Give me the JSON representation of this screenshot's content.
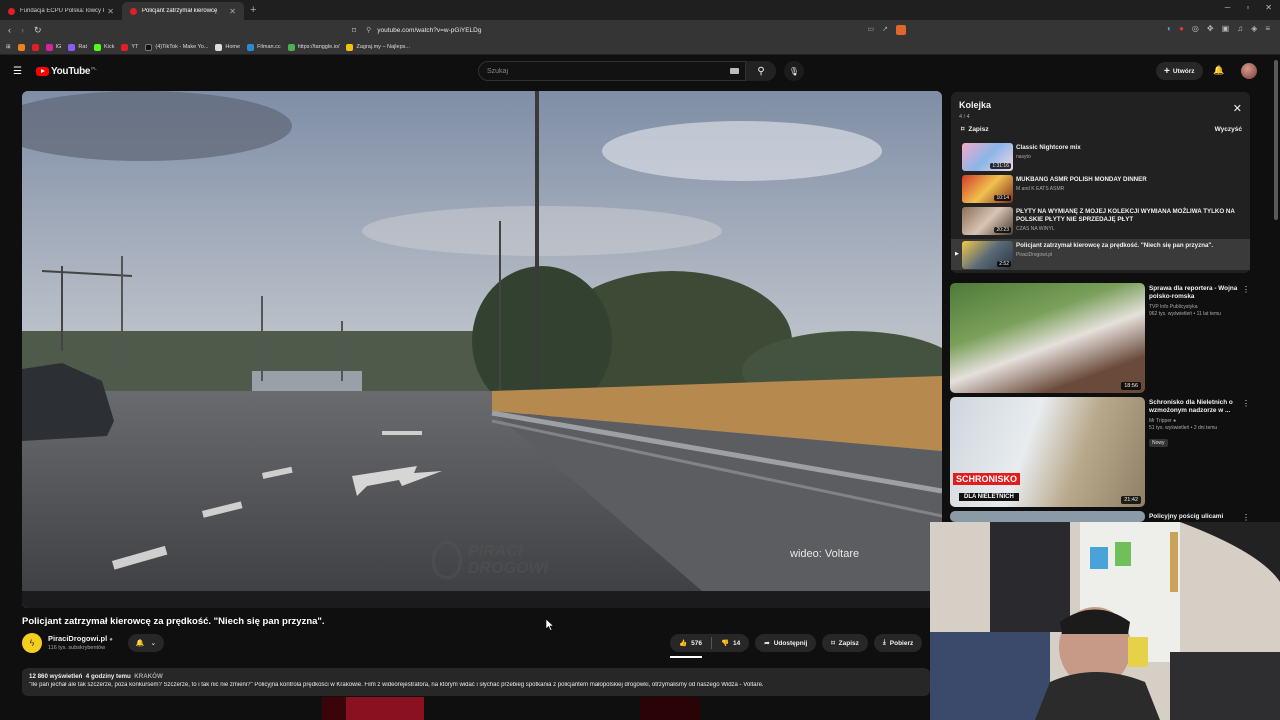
{
  "browser": {
    "tabs": [
      {
        "title": "Fundacja ECPU Polska: łowcy Pedofi",
        "active": false
      },
      {
        "title": "Policjant zatrzymał kierowcę",
        "active": true
      }
    ],
    "url": "youtube.com/watch?v=w-pGiYELDg",
    "bookmarks": [
      "IG",
      "Rat",
      "Kick",
      "YT",
      "(4)TikTok - Make Yo...",
      "Home",
      "Filman.cc",
      "https://tanggle.io/",
      "Zagraj.my – Najleps..."
    ]
  },
  "header": {
    "logo_text": "YouTube",
    "country": "PL",
    "search_placeholder": "Szukaj",
    "create_label": "Utwórz"
  },
  "player": {
    "watermark_line1": "PIRACI",
    "watermark_line2": "DROGOWI",
    "credit": "wideo: Voltare"
  },
  "video": {
    "title": "Policjant zatrzymał kierowcę za prędkość. \"Niech się pan przyzna\".",
    "channel": "PiraciDrogowi.pl",
    "subscribers": "116 tys. subskrybentów",
    "likes": "576",
    "dislikes": "14",
    "share_label": "Udostępnij",
    "save_label": "Zapisz",
    "download_label": "Pobierz",
    "views": "12 860 wyświetleń",
    "age": "4 godziny temu",
    "tag": "KRAKÓW",
    "description": "\"Ile pan jechał ale tak szczerze, poza konkursem? Szczerze, to i tak nic nie zmieni?\" Policyjna kontrola prędkości w Krakowie. Film z wideorejestratora, na którym widać i słychać przebieg spotkania z policjantem małopolskiej drogówki, otrzymaliśmy od naszego Widza - Voltare."
  },
  "queue": {
    "title": "Kolejka",
    "count": "4 / 4",
    "save_label": "Zapisz",
    "clear_label": "Wyczyść",
    "items": [
      {
        "title": "Classic Nightcore mix",
        "channel": "nasyto",
        "duration": "1:31:16"
      },
      {
        "title": "MUKBANG ASMR POLISH MONDAY DINNER",
        "channel": "M and K EATS ASMR",
        "duration": "10:14"
      },
      {
        "title": "PŁYTY NA WYMIANĘ Z MOJEJ KOLEKCJI WYMIANA MOŻLIWA TYLKO NA POLSKIE PŁYTY NIE SPRZEDAJĘ PŁYT",
        "channel": "CZAS NA WINYL",
        "duration": "20:23"
      },
      {
        "title": "Policjant zatrzymał kierowcę za prędkość. \"Niech się pan przyzna\".",
        "channel": "PiraciDrogowi.pl",
        "duration": "2:52"
      }
    ]
  },
  "recommendations": [
    {
      "title": "Sprawa dla reportera - Wojna polsko-romska",
      "channel": "TVP Info Publicystyka",
      "meta": "962 tys. wyświetleń • 11 lat temu",
      "duration": "18:56"
    },
    {
      "title": "Schronisko dla Nieletnich o wzmożonym nadzorze w ...",
      "channel": "Mr Tripper",
      "meta": "51 tys. wyświetleń • 2 dni temu",
      "badge": "Nowy",
      "duration": "21:42",
      "overlay1": "SCHRONISKO",
      "overlay2": "DLA NIELETNICH"
    },
    {
      "title": "Policyjny pościg ulicami",
      "channel": "",
      "meta": "",
      "duration": ""
    }
  ]
}
